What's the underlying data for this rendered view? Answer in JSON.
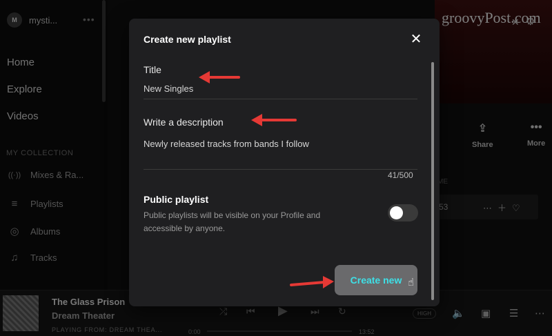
{
  "sidebar": {
    "avatar_initial": "M",
    "profile_name": "mysti...",
    "more_icon": "•••",
    "nav": [
      {
        "label": "Home"
      },
      {
        "label": "Explore"
      },
      {
        "label": "Videos"
      }
    ],
    "collection_title": "MY COLLECTION",
    "collection": [
      {
        "icon": "radio-icon",
        "glyph": "((·))",
        "label": "Mixes & Ra..."
      },
      {
        "icon": "playlist-icon",
        "glyph": "≡",
        "label": "Playlists"
      },
      {
        "icon": "album-icon",
        "glyph": "◎",
        "label": "Albums"
      },
      {
        "icon": "note-icon",
        "glyph": "♫",
        "label": "Tracks"
      }
    ]
  },
  "background": {
    "watermark": "groovyPost.com",
    "actions": [
      {
        "label": "Share",
        "glyph": "⇪"
      },
      {
        "label": "More",
        "glyph": "•••"
      }
    ],
    "row_number": "53",
    "section_label": "ME"
  },
  "player": {
    "track_title": "The Glass Prison",
    "track_artist": "Dream Theater",
    "playing_from": "PLAYING FROM: DREAM THEA...",
    "time_elapsed": "0:00",
    "time_total": "13:52",
    "quality": "HIGH"
  },
  "modal": {
    "title": "Create new playlist",
    "title_label": "Title",
    "title_value": "New Singles",
    "description_label": "Write a description",
    "description_value": "Newly released tracks from bands I follow",
    "counter": "41/500",
    "public_title": "Public playlist",
    "public_desc": "Public playlists will be visible on your Profile and accessible by anyone.",
    "public_enabled": false,
    "create_label": "Create new"
  },
  "colors": {
    "accent": "#3ee0e7",
    "arrow": "#e53935",
    "modal_bg": "#1f1f21"
  }
}
